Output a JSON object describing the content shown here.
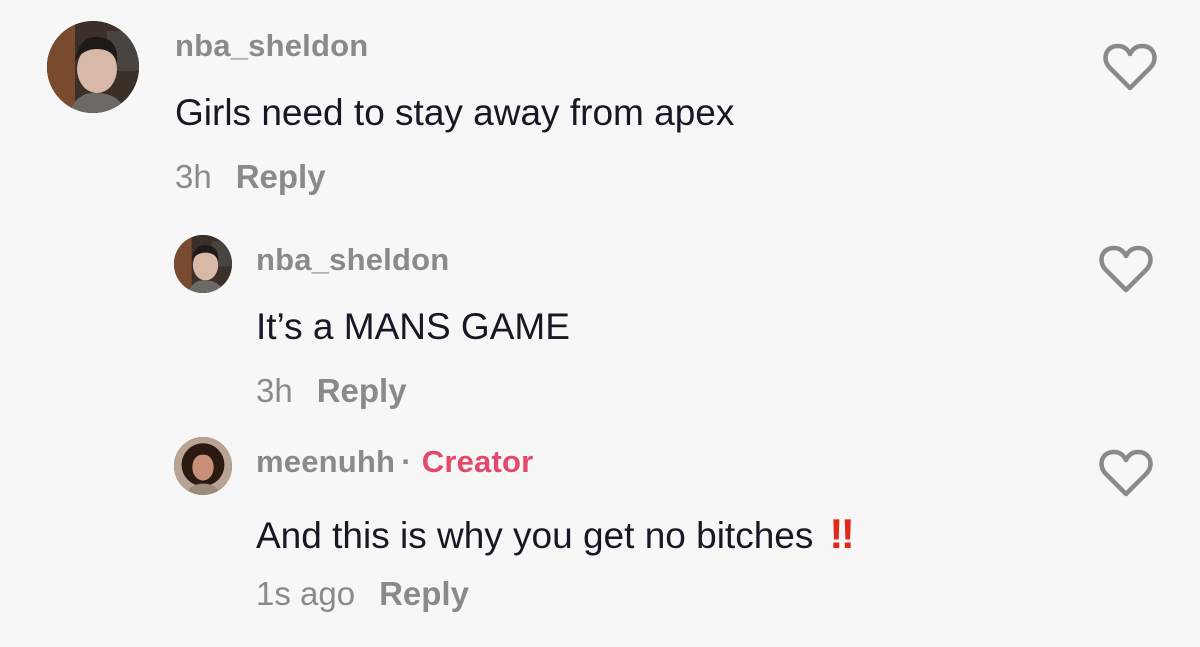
{
  "comments": [
    {
      "username": "nba_sheldon",
      "text": "Girls need to stay away from apex",
      "time": "3h",
      "reply_label": "Reply",
      "avatar_icon": "user-avatar-photo"
    },
    {
      "username": "nba_sheldon",
      "text": "It’s a MANS GAME",
      "time": "3h",
      "reply_label": "Reply",
      "avatar_icon": "user-avatar-photo"
    },
    {
      "username": "meenuhh",
      "separator": "·",
      "badge": "Creator",
      "text": "And this is why you get no bitches",
      "emoji": "‼",
      "time": "1s ago",
      "reply_label": "Reply",
      "avatar_icon": "user-avatar-photo"
    }
  ],
  "colors": {
    "background": "#f7f7f7",
    "creator_badge": "#e3496a",
    "muted": "#8a8a8a",
    "text": "#161823",
    "emoji": "#e0281b"
  },
  "like_icon": "heart-outline-icon"
}
